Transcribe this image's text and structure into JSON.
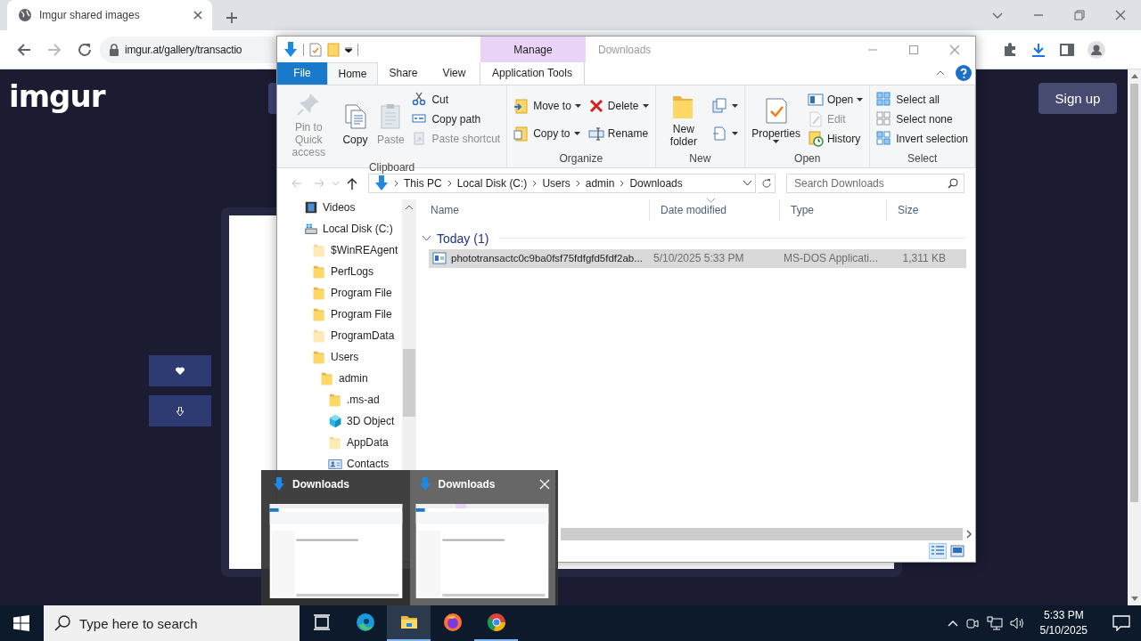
{
  "browser": {
    "tab_title": "Imgur shared images",
    "url": "imgur.at/gallery/transactio"
  },
  "page": {
    "logo": "imgur",
    "sign_up": "Sign up"
  },
  "explorer": {
    "title": "Downloads",
    "context_label": "Manage",
    "ribbon_tabs": [
      {
        "label": "File",
        "kind": "file",
        "selected": false
      },
      {
        "label": "Home",
        "kind": "normal",
        "selected": true
      },
      {
        "label": "Share",
        "kind": "normal",
        "selected": false
      },
      {
        "label": "View",
        "kind": "normal",
        "selected": false
      },
      {
        "label": "Application Tools",
        "kind": "context",
        "selected": false
      }
    ],
    "ribbon_groups": [
      {
        "label": "Clipboard",
        "columns": [
          [
            {
              "kind": "pin",
              "label": "Pin to Quick access",
              "disabled": true,
              "dropdown": false
            }
          ],
          [
            {
              "kind": "copy",
              "label": "Copy",
              "disabled": false,
              "dropdown": false
            }
          ],
          [
            {
              "kind": "paste",
              "label": "Paste",
              "disabled": true,
              "dropdown": false
            }
          ],
          [
            {
              "kind": "cut",
              "label": "Cut",
              "disabled": false,
              "dropdown": false
            },
            {
              "kind": "copy-path",
              "label": "Copy path",
              "disabled": false,
              "dropdown": false
            },
            {
              "kind": "paste-shortcut",
              "label": "Paste shortcut",
              "disabled": true,
              "dropdown": false
            }
          ]
        ]
      },
      {
        "label": "Organize",
        "columns": [
          [
            {
              "kind": "move-to",
              "label": "Move to",
              "disabled": false,
              "dropdown": true
            },
            {
              "kind": "copy-to",
              "label": "Copy to",
              "disabled": false,
              "dropdown": true
            }
          ],
          [
            {
              "kind": "delete",
              "label": "Delete",
              "disabled": false,
              "dropdown": true
            },
            {
              "kind": "rename",
              "label": "Rename",
              "disabled": false,
              "dropdown": false
            }
          ]
        ]
      },
      {
        "label": "New",
        "columns": [
          [
            {
              "kind": "new-folder",
              "label": "New folder",
              "disabled": false,
              "dropdown": false
            }
          ],
          [
            {
              "kind": "new-item",
              "disabled": false,
              "dropdown": true
            },
            {
              "kind": "easy-access",
              "disabled": false,
              "dropdown": true
            }
          ]
        ]
      },
      {
        "label": "Open",
        "columns": [
          [
            {
              "kind": "properties",
              "label": "Properties",
              "disabled": false,
              "dropdown": true
            }
          ],
          [
            {
              "kind": "open",
              "label": "Open",
              "disabled": false,
              "dropdown": true
            },
            {
              "kind": "edit",
              "label": "Edit",
              "disabled": true,
              "dropdown": false
            },
            {
              "kind": "history",
              "label": "History",
              "disabled": false,
              "dropdown": false
            }
          ]
        ]
      },
      {
        "label": "Select",
        "columns": [
          [
            {
              "kind": "select-all",
              "label": "Select all",
              "disabled": false,
              "dropdown": false
            },
            {
              "kind": "select-none",
              "label": "Select none",
              "disabled": false,
              "dropdown": false
            },
            {
              "kind": "invert",
              "label": "Invert selection",
              "disabled": false,
              "dropdown": false
            }
          ]
        ]
      }
    ],
    "breadcrumb": [
      "This PC",
      "Local Disk (C:)",
      "Users",
      "admin",
      "Downloads"
    ],
    "search": {
      "placeholder": "Search Downloads"
    },
    "nav": [
      {
        "kind": "video",
        "label": "Videos"
      },
      {
        "kind": "drive",
        "label": "Local Disk (C:)",
        "children": [
          {
            "kind": "hidden-folder",
            "label": "$WinREAgent"
          },
          {
            "kind": "folder",
            "label": "PerfLogs"
          },
          {
            "kind": "folder",
            "label": "Program File"
          },
          {
            "kind": "folder",
            "label": "Program File"
          },
          {
            "kind": "hidden-folder",
            "label": "ProgramData"
          },
          {
            "kind": "folder",
            "label": "Users",
            "children": [
              {
                "kind": "folder",
                "label": "admin",
                "children": [
                  {
                    "kind": "folder",
                    "label": ".ms-ad"
                  },
                  {
                    "kind": "cube",
                    "label": "3D Object"
                  },
                  {
                    "kind": "hidden-folder",
                    "label": "AppData"
                  },
                  {
                    "kind": "contacts",
                    "label": "Contacts"
                  }
                ]
              }
            ]
          }
        ]
      }
    ],
    "columns": [
      "Name",
      "Date modified",
      "Type",
      "Size"
    ],
    "groups": [
      {
        "label": "Today (1)",
        "expanded": true,
        "rows": [
          {
            "name": "phototransactc0c9ba0fsf75fdfgfd5fdf2ab...",
            "date": "5/10/2025 5:33 PM",
            "type": "MS-DOS Applicati...",
            "size": "1,311 KB",
            "selected": true
          }
        ]
      }
    ]
  },
  "thumbnails": [
    {
      "title": "Downloads",
      "selected": false
    },
    {
      "title": "Downloads",
      "selected": true
    }
  ],
  "taskbar": {
    "search_placeholder": "Type here to search",
    "apps": [
      {
        "kind": "task-view",
        "selected": false,
        "running": false
      },
      {
        "kind": "edge",
        "selected": false,
        "running": false
      },
      {
        "kind": "explorer",
        "selected": true,
        "running": true
      },
      {
        "kind": "firefox",
        "selected": false,
        "running": false
      },
      {
        "kind": "chrome",
        "selected": false,
        "running": true
      }
    ],
    "time": "5:33 PM",
    "date": "5/10/2025"
  }
}
